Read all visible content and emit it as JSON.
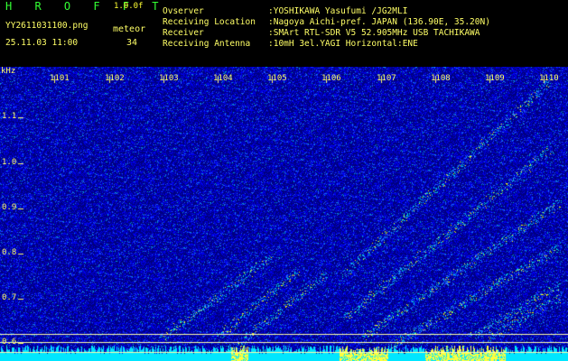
{
  "header": {
    "title": "H R O F F T",
    "version": "1.0.0f",
    "filename": "YY2611031100.png",
    "datetime": "25.11.03 11:00",
    "meteor_label": "meteor",
    "meteor_count": "34"
  },
  "info": {
    "observer_key": "Ovserver",
    "observer_val": ":YOSHIKAWA Yasufumi /JG2MLI",
    "location_key": "Receiving Location",
    "location_val": ":Nagoya Aichi-pref. JAPAN (136.90E, 35.20N)",
    "receiver_key": "Receiver",
    "receiver_val": ":SMArt RTL-SDR V5 52.905MHz USB TACHIKAWA",
    "antenna_key": "Receiving Antenna",
    "antenna_val": ":10mH 3el.YAGI Horizontal:ENE"
  },
  "plot": {
    "unit_label": "kHz",
    "y_ticks": [
      "1.1",
      "1.0",
      "0.9",
      "0.8",
      "0.7",
      "0.6"
    ],
    "x_ticks": [
      "1101",
      "1102",
      "1103",
      "1104",
      "1105",
      "1106",
      "1107",
      "1108",
      "1109",
      "1110"
    ],
    "colors": {
      "background": "#000080",
      "noise_low": "#0000cc",
      "noise_high": "#2a5cff",
      "signal_mid": "#00ccdd",
      "signal_high": "#ffff00",
      "reference_line": "#ffffaa"
    }
  }
}
